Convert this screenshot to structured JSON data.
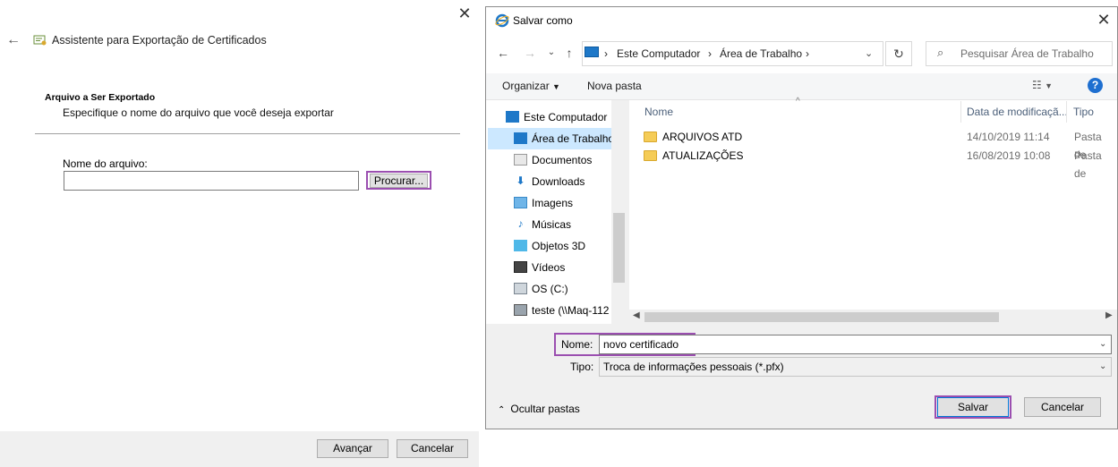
{
  "wizard": {
    "title": "Assistente para Exportação de Certificados",
    "section_title": "Arquivo a Ser Exportado",
    "section_subtitle": "Especifique o nome do arquivo que você deseja exportar",
    "filename_label": "Nome do arquivo:",
    "filename_value": "",
    "browse_label": "Procurar...",
    "next_label": "Avançar",
    "cancel_label": "Cancelar",
    "close_glyph": "✕",
    "back_glyph": "←"
  },
  "save_dialog": {
    "title": "Salvar como",
    "close_glyph": "✕",
    "breadcrumb": [
      "Este Computador",
      "Área de Trabalho"
    ],
    "search_placeholder": "Pesquisar Área de Trabalho",
    "toolbar": {
      "organize_label": "Organizar",
      "new_folder_label": "Nova pasta"
    },
    "nav_items": [
      {
        "label": "Este Computador",
        "icon": "computer-icon"
      },
      {
        "label": "Área de Trabalho",
        "icon": "desktop-icon",
        "selected": true
      },
      {
        "label": "Documentos",
        "icon": "documents-icon"
      },
      {
        "label": "Downloads",
        "icon": "download-icon"
      },
      {
        "label": "Imagens",
        "icon": "pictures-icon"
      },
      {
        "label": "Músicas",
        "icon": "music-icon"
      },
      {
        "label": "Objetos 3D",
        "icon": "cube-icon"
      },
      {
        "label": "Vídeos",
        "icon": "video-icon"
      },
      {
        "label": "OS (C:)",
        "icon": "drive-icon"
      },
      {
        "label": "teste (\\\\Maq-112",
        "icon": "network-drive-icon"
      }
    ],
    "columns": {
      "name": "Nome",
      "date": "Data de modificaçã...",
      "type": "Tipo"
    },
    "files": [
      {
        "name": "ARQUIVOS ATD",
        "date": "14/10/2019 11:14",
        "type": "Pasta de"
      },
      {
        "name": "ATUALIZAÇÕES",
        "date": "16/08/2019 10:08",
        "type": "Pasta de"
      }
    ],
    "name_label": "Nome:",
    "name_value": "novo certificado",
    "type_label": "Tipo:",
    "type_value": "Troca de informações pessoais (*.pfx)",
    "hide_folders_label": "Ocultar pastas",
    "save_label": "Salvar",
    "cancel_label": "Cancelar"
  },
  "colors": {
    "highlight": "#9b4fb0",
    "selection": "#cce8ff",
    "accent": "#0078d7",
    "folder": "#f5cc57"
  }
}
